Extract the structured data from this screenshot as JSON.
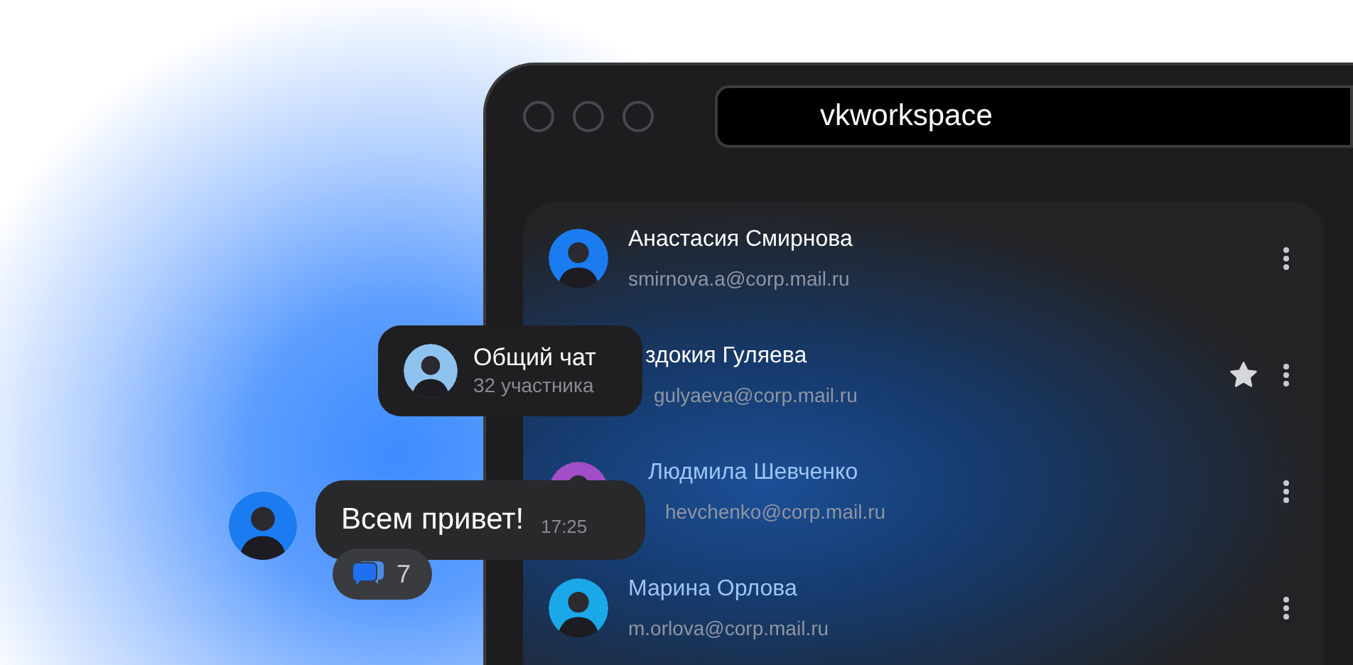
{
  "window": {
    "address": "vkworkspace"
  },
  "contacts": [
    {
      "name": "Анастасия Смирнова",
      "email": "smirnova.a@corp.mail.ru",
      "starred": false
    },
    {
      "name": "здокия Гуляева",
      "email": "gulyaeva@corp.mail.ru",
      "starred": true
    },
    {
      "name": "Людмила Шевченко",
      "email": "hevchenko@corp.mail.ru",
      "starred": false
    },
    {
      "name": "Марина Орлова",
      "email": "m.orlova@corp.mail.ru",
      "starred": false
    }
  ],
  "group_chat": {
    "title": "Общий чат",
    "members": "32 участника"
  },
  "message": {
    "text": "Всем привет!",
    "time": "17:25",
    "replies": "7"
  }
}
